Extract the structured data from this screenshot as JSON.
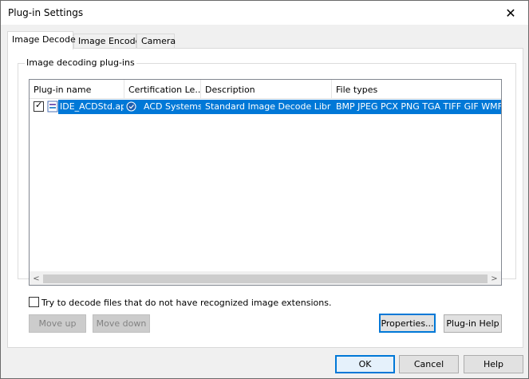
{
  "window": {
    "title": "Plug-in Settings",
    "close_glyph": "✕"
  },
  "tabs": [
    {
      "label": "Image Decode",
      "active": true
    },
    {
      "label": "Image Encode",
      "active": false
    },
    {
      "label": "Camera",
      "active": false
    }
  ],
  "group": {
    "title": "Image decoding plug-ins"
  },
  "list": {
    "columns": [
      "Plug-in name",
      "Certification Le...",
      "Description",
      "File types"
    ],
    "rows": [
      {
        "checked": true,
        "name": "IDE_ACDStd.apl",
        "certification": "ACD Systems",
        "description": "Standard Image Decode Library",
        "file_types": "BMP JPEG PCX PNG TGA TIFF GIF WMF EMF",
        "icon": "plugin-file-icon",
        "cert_icon": "certificate-icon"
      }
    ],
    "scroll_left_glyph": "<",
    "scroll_right_glyph": ">"
  },
  "options": {
    "try_decode_label": "Try to decode files that do not have recognized image extensions.",
    "try_decode_checked": false
  },
  "buttons": {
    "move_up": "Move up",
    "move_down": "Move down",
    "properties": "Properties...",
    "plugin_help": "Plug-in Help",
    "ok": "OK",
    "cancel": "Cancel",
    "help": "Help"
  },
  "colors": {
    "selection": "#0078d7",
    "focus_border": "#0078d7"
  }
}
